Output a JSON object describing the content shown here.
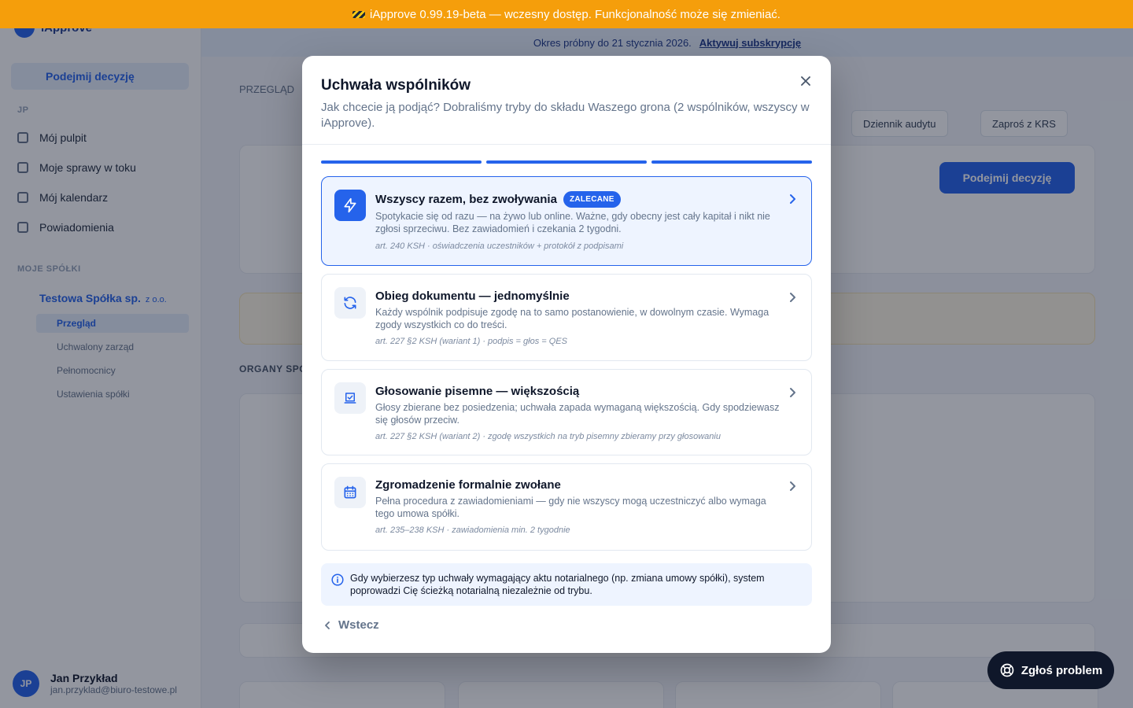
{
  "beta_banner": {
    "text": "iApprove 0.99.19-beta — wczesny dostęp. Funkcjonalność może się zmieniać."
  },
  "background": {
    "sidebar": {
      "app_name": "iApprove",
      "new_decision": "Podejmij decyzję",
      "section_main": "JP",
      "items": [
        "Mój pulpit",
        "Moje sprawy w toku",
        "Mój kalendarz",
        "Powiadomienia"
      ],
      "section_companies": "MOJE SPÓŁKI",
      "company": "Testowa Spółka sp.",
      "company_tag": "z o.o.",
      "sub_items": [
        "Przegląd",
        "Uchwalony zarząd",
        "Pełnomocnicy",
        "Ustawienia spółki"
      ],
      "user_initials": "JP",
      "user_name": "Jan Przykład",
      "user_email": "jan.przyklad@biuro-testowe.pl"
    },
    "trial": {
      "text": "Okres próbny do 21 stycznia 2026.",
      "link": "Aktywuj subskrypcję"
    },
    "breadcrumb": "PRZEGLĄD",
    "buttons": {
      "audit": "Dziennik audytu",
      "invite": "Zaproś z KRS"
    },
    "primary": "Podejmij decyzję",
    "section_label": "ORGANY SPÓŁKI"
  },
  "modal": {
    "title": "Uchwała wspólników",
    "subtitle": "Jak chcecie ją podjąć? Dobraliśmy tryby do składu Waszego grona (2 wspólników, wszyscy w iApprove).",
    "steps_total": 3,
    "steps_completed": 3,
    "options": [
      {
        "title": "Wszyscy razem, bez zwoływania",
        "badge": "ZALECANE",
        "description": "Spotykacie się od razu — na żywo lub online. Ważne, gdy obecny jest cały kapitał i nikt nie zgłosi sprzeciwu. Bez zawiadomień i czekania 2 tygodni.",
        "reference": "art. 240 KSH · oświadczenia uczestników + protokół z podpisami",
        "icon": "lightning-icon"
      },
      {
        "title": "Obieg dokumentu — jednomyślnie",
        "description": "Każdy wspólnik podpisuje zgodę na to samo postanowienie, w dowolnym czasie. Wymaga zgody wszystkich co do treści.",
        "reference": "art. 227 §2 KSH (wariant 1) · podpis = głos = QES",
        "icon": "refresh-icon"
      },
      {
        "title": "Głosowanie pisemne — większością",
        "description": "Głosy zbierane bez posiedzenia; uchwała zapada wymaganą większością. Gdy spodziewasz się głosów przeciw.",
        "reference": "art. 227 §2 KSH (wariant 2) · zgodę wszystkich na tryb pisemny zbieramy przy głosowaniu",
        "icon": "ballot-icon"
      },
      {
        "title": "Zgromadzenie formalnie zwołane",
        "description": "Pełna procedura z zawiadomieniami — gdy nie wszyscy mogą uczestniczyć albo wymaga tego umowa spółki.",
        "reference": "art. 235–238 KSH · zawiadomienia min. 2 tygodnie",
        "icon": "calendar-icon"
      }
    ],
    "info": "Gdy wybierzesz typ uchwały wymagający aktu notarialnego (np. zmiana umowy spółki), system poprowadzi Cię ścieżką notarialną niezależnie od trybu.",
    "back": "Wstecz"
  },
  "report_button": "Zgłoś problem",
  "colors": {
    "accent": "#2563eb",
    "banner": "#f59e0b",
    "dark": "#0f172a"
  }
}
